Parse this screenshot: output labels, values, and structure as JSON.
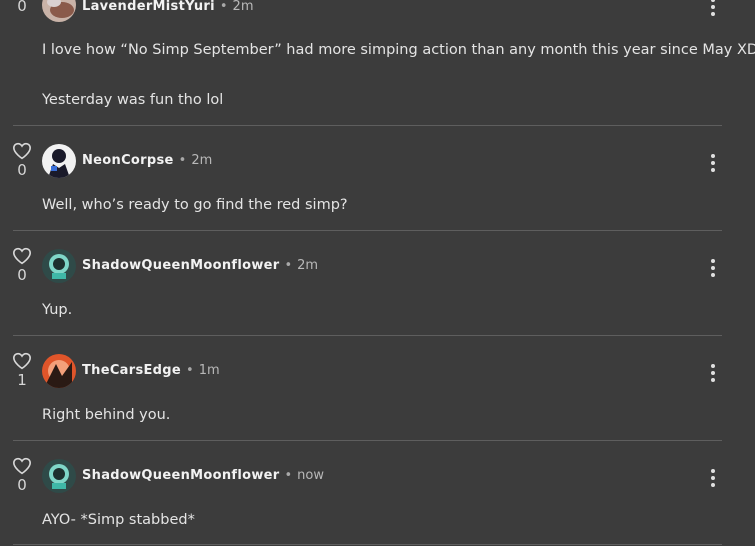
{
  "comments": [
    {
      "user": "LavenderMistYuri",
      "time": "2m",
      "likes": "0",
      "lines": [
        "I love how “No Simp September” had more simping action than any month this year since May XD",
        "Yesterday was fun tho lol"
      ]
    },
    {
      "user": "NeonCorpse",
      "time": "2m",
      "likes": "0",
      "lines": [
        "Well, who’s ready to go find the red simp?"
      ]
    },
    {
      "user": "ShadowQueenMoonflower",
      "time": "2m",
      "likes": "0",
      "lines": [
        "Yup."
      ]
    },
    {
      "user": "TheCarsEdge",
      "time": "1m",
      "likes": "1",
      "lines": [
        "Right behind you."
      ]
    },
    {
      "user": "ShadowQueenMoonflower",
      "time": "now",
      "likes": "0",
      "lines": [
        "AYO- *Simp stabbed*"
      ]
    }
  ],
  "icons": {
    "like": "heart-outline-icon",
    "menu": "vertical-ellipsis-icon"
  },
  "colors": {
    "background": "#3c3c3c",
    "separator": "#5e5e5e",
    "username": "#f2f2f2",
    "timestamp": "#b8b8b8"
  }
}
